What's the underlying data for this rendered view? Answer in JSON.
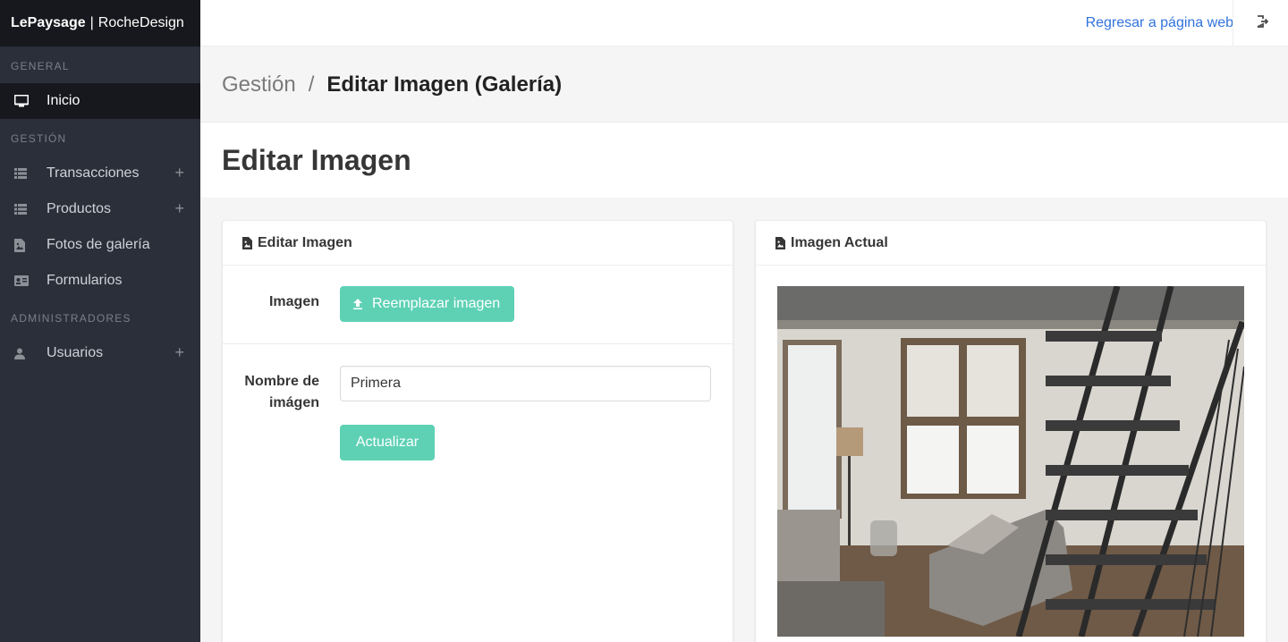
{
  "brand": {
    "name_bold": "LePaysage",
    "separator": "|",
    "name_light": "RocheDesign"
  },
  "sidebar": {
    "sections": {
      "general": "GENERAL",
      "gestion": "GESTIÓN",
      "admins": "ADMINISTRADORES"
    },
    "items": [
      {
        "label": "Inicio",
        "icon": "monitor-icon",
        "active": true
      },
      {
        "label": "Transacciones",
        "icon": "list-icon",
        "expandable": true
      },
      {
        "label": "Productos",
        "icon": "list-icon",
        "expandable": true
      },
      {
        "label": "Fotos de galería",
        "icon": "file-image-icon"
      },
      {
        "label": "Formularios",
        "icon": "id-card-icon"
      },
      {
        "label": "Usuarios",
        "icon": "user-icon",
        "expandable": true
      }
    ],
    "expand_symbol": "+"
  },
  "navbar": {
    "link": "Regresar a página web",
    "logout_icon": "logout-icon"
  },
  "breadcrumb": {
    "parent": "Gestión",
    "separator": "/",
    "current": "Editar Imagen (Galería)"
  },
  "page": {
    "title": "Editar Imagen"
  },
  "edit_card": {
    "title": "Editar Imagen",
    "image_label": "Imagen",
    "upload_button": "Reemplazar imagen",
    "name_label_line1": "Nombre de",
    "name_label_line2": "imágen",
    "name_value": "Primera",
    "submit_button": "Actualizar"
  },
  "preview_card": {
    "title": "Imagen Actual"
  },
  "colors": {
    "accent": "#5ed1b5",
    "link": "#3273dc",
    "sidebar": "#2b2f3a",
    "sidebar_dark": "#17181d"
  }
}
